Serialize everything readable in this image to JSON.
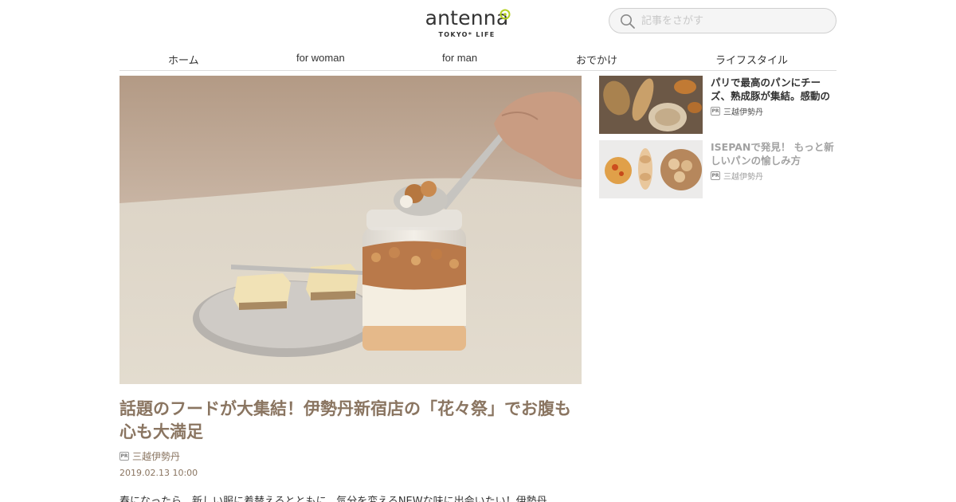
{
  "header": {
    "logo_word": "antenna",
    "logo_sub": "TOKYO* LIFE",
    "search_placeholder": "記事をさがす"
  },
  "nav": {
    "items": [
      {
        "label": "ホーム"
      },
      {
        "label": "for woman"
      },
      {
        "label": "for man"
      },
      {
        "label": "おでかけ"
      },
      {
        "label": "ライフスタイル"
      }
    ]
  },
  "article": {
    "title": "話題のフードが大集結！伊勢丹新宿店の「花々祭」でお腹も心も大満足",
    "pr_badge": "PR",
    "sponsor": "三越伊勢丹",
    "date": "2019.02.13 10:00",
    "excerpt": "春になったら、新しい服に着替えるとともに、気分を変えるNEWな味に出会いたい！伊勢丹"
  },
  "sidebar": {
    "cards": [
      {
        "title": "パリで最高のパンにチーズ、熟成豚が集結。感動の",
        "pr_badge": "PR",
        "sponsor": "三越伊勢丹"
      },
      {
        "title": "ISEPANで発見！ もっと新しいパンの愉しみ方",
        "pr_badge": "PR",
        "sponsor": "三越伊勢丹"
      }
    ]
  },
  "colors": {
    "title_accent": "#8a7561",
    "logo_lime": "#b4d020",
    "divider": "#dcdcdc"
  },
  "icons": {
    "search": "search-icon",
    "logo_mark": "flower-icon"
  }
}
